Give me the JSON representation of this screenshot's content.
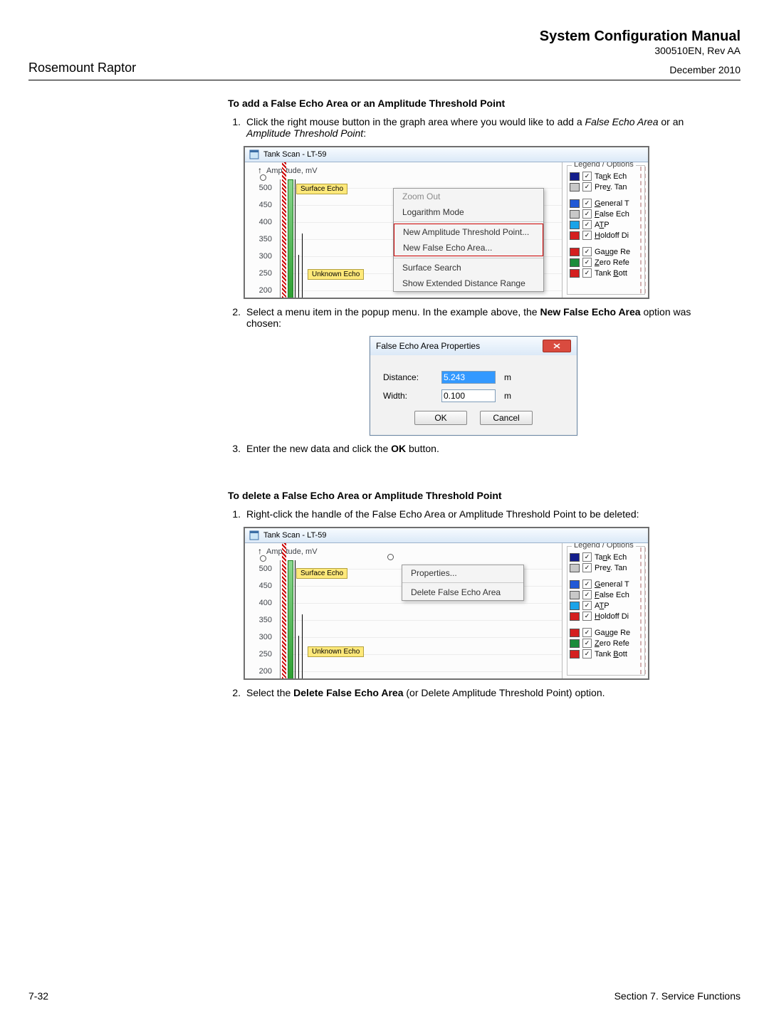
{
  "header": {
    "doc_title": "System Configuration Manual",
    "doc_id": "300510EN, Rev AA",
    "product": "Rosemount Raptor",
    "date": "December 2010"
  },
  "section1": {
    "heading": "To add a False Echo Area or an Amplitude Threshold Point",
    "step1_num": "1.",
    "step1_a": "Click the right mouse button in the graph area where you would like to add a ",
    "step1_b": "False Echo Area",
    "step1_c": " or an ",
    "step1_d": "Amplitude Threshold Point",
    "step1_e": ":",
    "step2_num": "2.",
    "step2_a": "Select a menu item in the popup menu. In the example above, the ",
    "step2_b": "New False Echo Area",
    "step2_c": " option was chosen:",
    "step3_num": "3.",
    "step3_a": "Enter the new data and click the ",
    "step3_b": "OK",
    "step3_c": " button."
  },
  "section2": {
    "heading": "To delete a False Echo Area or Amplitude Threshold Point",
    "step1_num": "1.",
    "step1_a": "Right-click the handle of the False Echo Area or Amplitude Threshold Point to be deleted:",
    "step2_num": "2.",
    "step2_a": "Select the ",
    "step2_b": "Delete False Echo Area",
    "step2_c": " (or Delete Amplitude Threshold Point) option."
  },
  "scr1": {
    "title": "Tank Scan - LT-59",
    "y_axis_label": "Amplitude, mV",
    "surface_label": "Surface Echo",
    "unknown_label": "Unknown Echo",
    "menu": {
      "zoom_out": "Zoom Out",
      "log_mode": "Logarithm Mode",
      "new_atp": "New Amplitude Threshold Point...",
      "new_fea": "New False Echo Area...",
      "surf_search": "Surface Search",
      "ext_range": "Show Extended Distance Range"
    }
  },
  "scr2": {
    "title": "Tank Scan - LT-59",
    "y_axis_label": "Amplitude, mV",
    "surface_label": "Surface Echo",
    "unknown_label": "Unknown Echo",
    "menu": {
      "properties": "Properties...",
      "delete_fea": "Delete False Echo Area"
    }
  },
  "legend": {
    "title": "Legend / Options",
    "tank_echo": "Tank Ech",
    "prev_tank": "Prev. Tan",
    "general_t": "General T",
    "false_ech": "False Ech",
    "atp": "ATP",
    "holdoff": "Holdoff Di",
    "gauge_re": "Gauge Re",
    "zero_refe": "Zero Refe",
    "tank_bott": "Tank Bott",
    "tank_echo_u": "n",
    "prev_tank_u": "v",
    "general_t_u": "G",
    "false_ech_u": "F",
    "atp_u": "T",
    "holdoff_u": "H",
    "gauge_re_u": "u",
    "zero_refe_u": "Z",
    "tank_bott_u": "B"
  },
  "dialog": {
    "title": "False Echo Area Properties",
    "dist_label": "Distance:",
    "dist_value": "5.243",
    "dist_unit": "m",
    "width_label": "Width:",
    "width_value": "0.100",
    "width_unit": "m",
    "ok": "OK",
    "cancel": "Cancel"
  },
  "footer": {
    "page": "7-32",
    "section": "Section 7. Service Functions"
  },
  "chart_data": {
    "type": "line",
    "ylabel": "Amplitude, mV",
    "ylim": [
      200,
      500
    ],
    "y_ticks": [
      500,
      450,
      400,
      350,
      300,
      250,
      200
    ],
    "peaks": [
      {
        "label": "Surface Echo",
        "x_approx": 0.03,
        "amplitude_mV": 520
      },
      {
        "label": "Unknown Echo",
        "x_approx": 0.07,
        "amplitude_mV": 260
      }
    ]
  }
}
